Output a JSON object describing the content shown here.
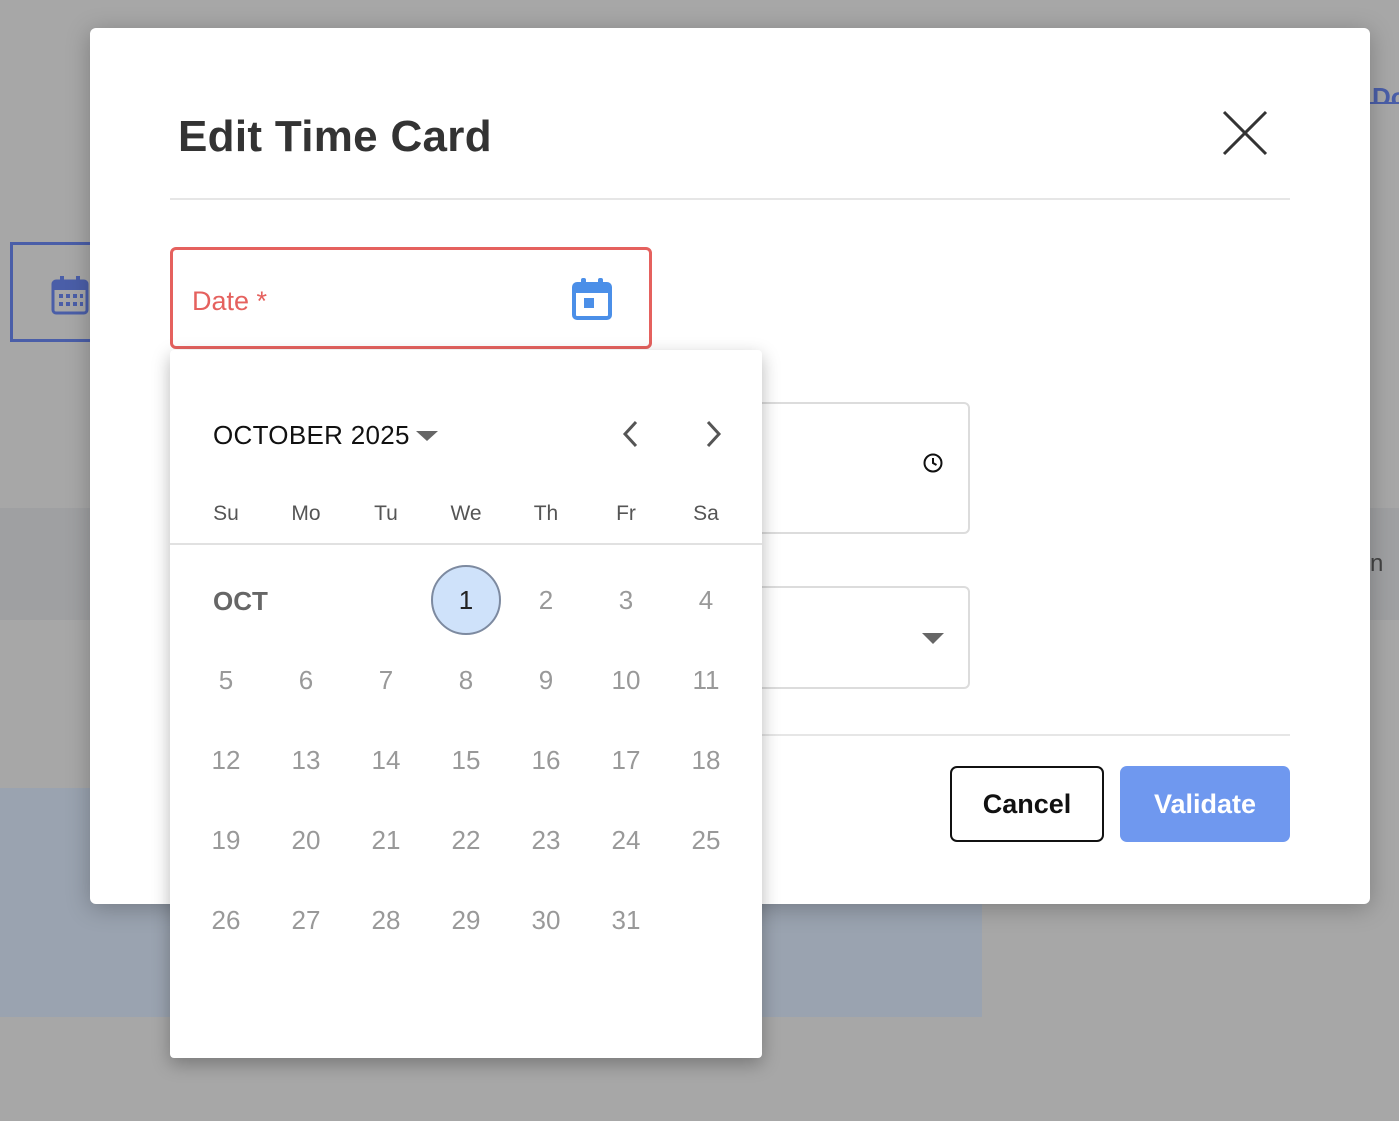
{
  "background": {
    "right_link_text": "Do",
    "right_text": "n"
  },
  "modal": {
    "title": "Edit Time Card",
    "date_field": {
      "label": "Date *"
    },
    "buttons": {
      "cancel": "Cancel",
      "validate": "Validate"
    }
  },
  "datepicker": {
    "month_year": "OCTOBER 2025",
    "month_short": "OCT",
    "weekdays": [
      "Su",
      "Mo",
      "Tu",
      "We",
      "Th",
      "Fr",
      "Sa"
    ],
    "first_day_weekday": 3,
    "days_in_month": 31,
    "selected_day": 1
  },
  "colors": {
    "error": "#e5615e",
    "accent": "#6f98ef",
    "selected_day_bg": "#cfe2fa"
  },
  "icons": [
    "close-icon",
    "calendar-icon",
    "clock-icon",
    "chevron-left-icon",
    "chevron-right-icon",
    "caret-down-icon"
  ]
}
